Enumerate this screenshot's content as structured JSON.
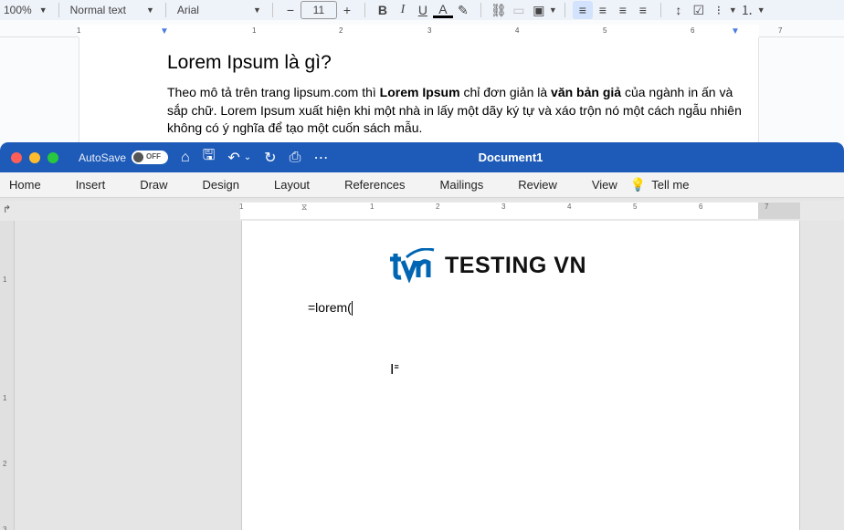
{
  "gdocs": {
    "zoom": "100%",
    "style": "Normal text",
    "font": "Arial",
    "font_size": "11",
    "ruler_numbers": [
      "1",
      "1",
      "2",
      "3",
      "4",
      "5",
      "6",
      "7"
    ],
    "heading": "Lorem Ipsum là gì?",
    "para_part1": "Theo mô tả trên trang lipsum.com thì ",
    "para_bold1": "Lorem Ipsum",
    "para_part2": " chỉ đơn giản là ",
    "para_bold2": "văn bản giả",
    "para_part3": " của ngành in ấn và sắp chữ. Lorem Ipsum xuất hiện khi một nhà in lấy một dãy ký tự và xáo trộn nó một cách ngẫu nhiên không có ý nghĩa để tạo một cuốn sách mẫu."
  },
  "word": {
    "autosave_label": "AutoSave",
    "autosave_state": "OFF",
    "title": "Document1",
    "tabs": [
      "Home",
      "Insert",
      "Draw",
      "Design",
      "Layout",
      "References",
      "Mailings",
      "Review",
      "View",
      "Tell me"
    ],
    "ruler_numbers": [
      "1",
      "1",
      "2",
      "3",
      "4",
      "5",
      "6",
      "7"
    ],
    "vruler_numbers": [
      "1",
      "1",
      "2",
      "3"
    ],
    "logo_text": "TESTING VN",
    "typed_text": "=lorem("
  },
  "colors": {
    "word_titlebar": "#1e5bb8",
    "logo_blue": "#0066b3"
  }
}
